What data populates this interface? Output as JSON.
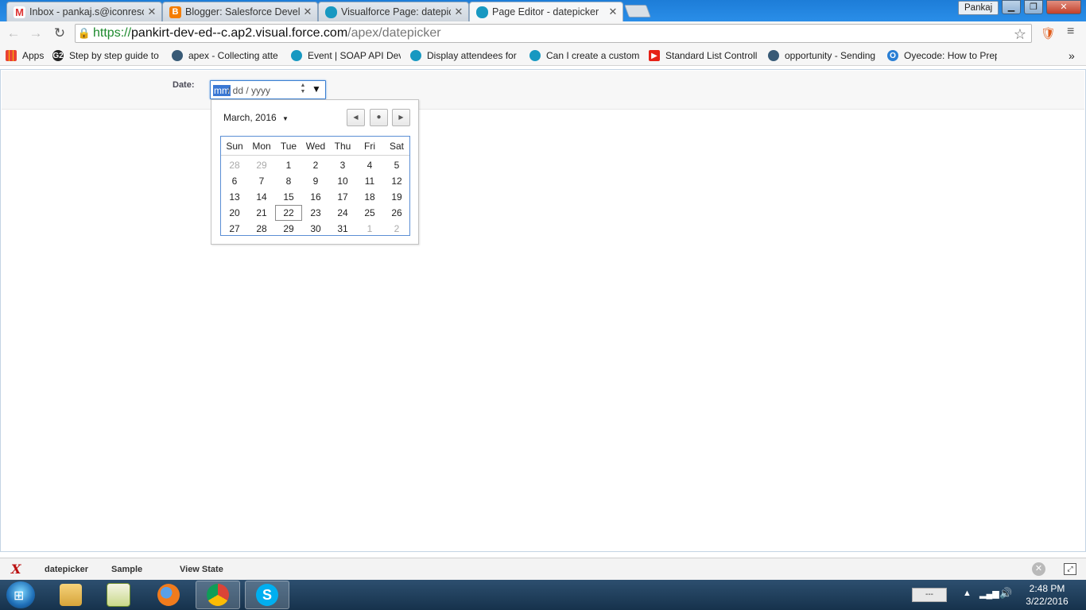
{
  "browser": {
    "tabs": [
      {
        "title": "Inbox - pankaj.s@iconreso",
        "favicon": "gmail-icon"
      },
      {
        "title": "Blogger: Salesforce Develo",
        "favicon": "blogger-icon"
      },
      {
        "title": "Visualforce Page: datepick",
        "favicon": "salesforce-cloud-icon"
      },
      {
        "title": "Page Editor - datepicker",
        "favicon": "salesforce-cloud-icon",
        "active": true
      }
    ],
    "profile_name": "Pankaj",
    "window_controls": {
      "minimize": "▁",
      "maximize": "❐",
      "close": "✕"
    },
    "url": {
      "scheme": "https://",
      "host": "pankirt-dev-ed--c.ap2.visual.force.com",
      "path": "/apex/datepicker"
    },
    "bookmarks": [
      {
        "label": "Apps",
        "icon": "apps-grid-icon"
      },
      {
        "label": "Step by step guide to",
        "icon": "g2-icon"
      },
      {
        "label": "apex - Collecting atte",
        "icon": "stackexchange-icon"
      },
      {
        "label": "Event | SOAP API Deve",
        "icon": "salesforce-cloud-icon"
      },
      {
        "label": "Display attendees for",
        "icon": "salesforce-cloud-icon"
      },
      {
        "label": "Can I create a custom",
        "icon": "salesforce-cloud-icon"
      },
      {
        "label": "Standard List Controll",
        "icon": "youtube-icon"
      },
      {
        "label": "opportunity - Sending",
        "icon": "stackexchange-icon"
      },
      {
        "label": "Oyecode: How to Prep",
        "icon": "oyecode-icon"
      }
    ],
    "bookmarks_overflow": "»"
  },
  "form": {
    "date_label": "Date:",
    "date_input": {
      "mm": "mm",
      "rest": "/ dd / yyyy"
    }
  },
  "calendar": {
    "month_label": "March, 2016",
    "weekdays": [
      "Sun",
      "Mon",
      "Tue",
      "Wed",
      "Thu",
      "Fri",
      "Sat"
    ],
    "weeks": [
      [
        "28",
        "29",
        "1",
        "2",
        "3",
        "4",
        "5"
      ],
      [
        "6",
        "7",
        "8",
        "9",
        "10",
        "11",
        "12"
      ],
      [
        "13",
        "14",
        "15",
        "16",
        "17",
        "18",
        "19"
      ],
      [
        "20",
        "21",
        "22",
        "23",
        "24",
        "25",
        "26"
      ],
      [
        "27",
        "28",
        "29",
        "30",
        "31",
        "1",
        "2"
      ]
    ],
    "today": "22"
  },
  "devbar": {
    "logo": "X",
    "links": [
      "datepicker",
      "Sample",
      "View State"
    ]
  },
  "taskbar": {
    "apps": [
      "windows-explorer-icon",
      "app-icon",
      "firefox-icon",
      "chrome-icon",
      "skype-icon"
    ],
    "battery_text": "---",
    "time": "2:48 PM",
    "date": "3/22/2016"
  }
}
